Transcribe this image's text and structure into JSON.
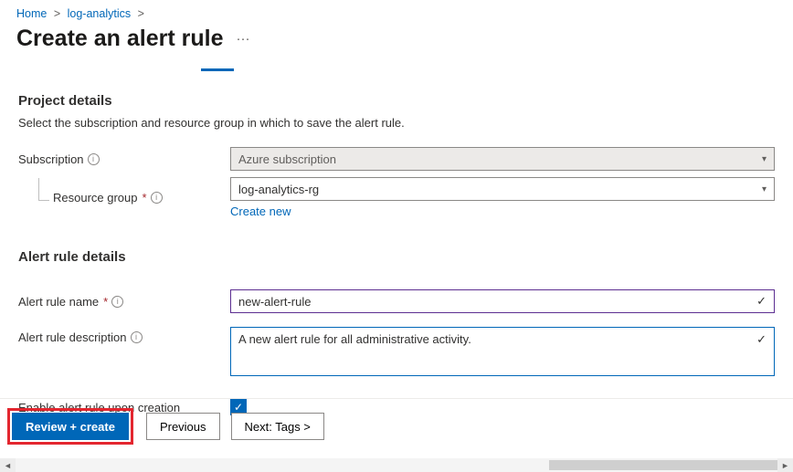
{
  "breadcrumb": {
    "home": "Home",
    "item": "log-analytics"
  },
  "page": {
    "title": "Create an alert rule"
  },
  "project": {
    "heading": "Project details",
    "subtext": "Select the subscription and resource group in which to save the alert rule.",
    "subscription_label": "Subscription",
    "subscription_value": "Azure subscription",
    "rg_label": "Resource group",
    "rg_value": "log-analytics-rg",
    "create_new": "Create new"
  },
  "details": {
    "heading": "Alert rule details",
    "name_label": "Alert rule name",
    "name_value": "new-alert-rule",
    "desc_label": "Alert rule description",
    "desc_value": "A new alert rule for all administrative activity.",
    "enable_label": "Enable alert rule upon creation",
    "enable_checked": true
  },
  "footer": {
    "review": "Review + create",
    "previous": "Previous",
    "next": "Next: Tags >"
  }
}
